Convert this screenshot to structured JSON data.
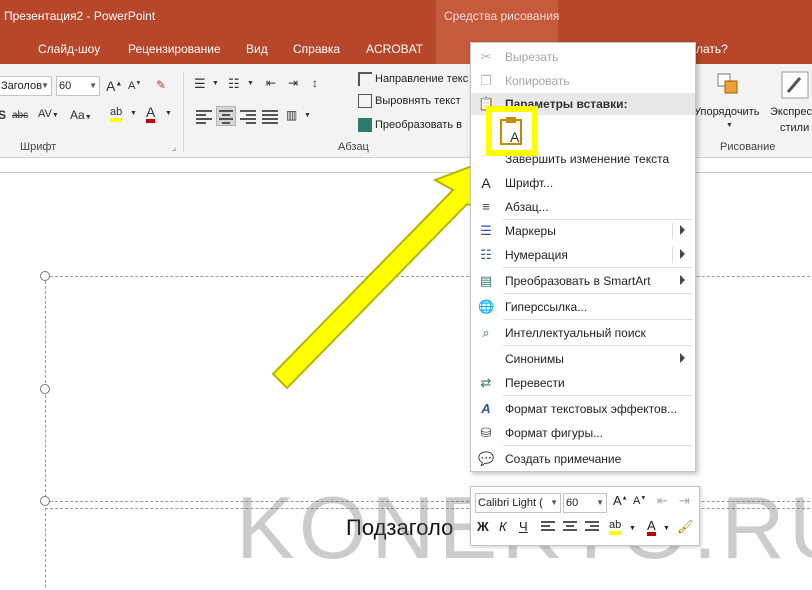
{
  "titlebar": {
    "title": "Презентация2  -  PowerPoint",
    "context_group": "Средства рисования"
  },
  "tabs": [
    "Слайд-шоу",
    "Рецензирование",
    "Вид",
    "Справка",
    "ACROBAT"
  ],
  "tell_me_partial": "лать?",
  "ribbon": {
    "font_name": "Заголов",
    "font_size": "60",
    "group_font": "Шрифт",
    "group_paragraph": "Абзац",
    "group_drawing": "Рисование",
    "text_direction": "Направление текс",
    "align_text": "Выровнять текст",
    "convert_smartart": "Преобразовать в",
    "arrange": "Упорядочить",
    "express_styles_line1": "Экспрес",
    "express_styles_line2": "стили"
  },
  "context_menu": {
    "cut": "Вырезать",
    "copy": "Копировать",
    "paste_options": "Параметры вставки:",
    "finish_edit": "Завершить изменение текста",
    "font": "Шрифт...",
    "paragraph": "Абзац...",
    "bullets": "Маркеры",
    "numbering": "Нумерация",
    "convert_smartart": "Преобразовать в SmartArt",
    "hyperlink": "Гиперссылка...",
    "smart_lookup": "Интеллектуальный поиск",
    "synonyms": "Синонимы",
    "translate": "Перевести",
    "text_effects": "Формат текстовых эффектов...",
    "shape_format": "Формат фигуры...",
    "new_comment": "Создать примечание"
  },
  "mini_toolbar": {
    "font_name": "Calibri Light (",
    "font_size": "60"
  },
  "slide": {
    "subtitle_partial": "Подзаголо"
  },
  "watermark": "KONEKTO.RU",
  "colors": {
    "accent": "#b7472a",
    "highlight": "#ffff00"
  }
}
